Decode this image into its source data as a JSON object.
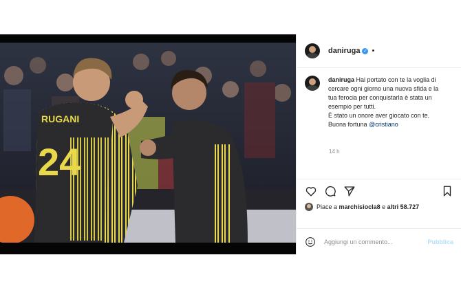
{
  "post": {
    "username": "daniruga",
    "verified_mark": "✓",
    "more_icon": "more-options-icon",
    "caption": {
      "username": "daniruga",
      "text": "Hai portato con te la voglia di cercare ogni giorno una nuova sfida e la tua ferocia per conquistarla è stata un esempio per tutti.",
      "text2": "È stato un onore aver giocato con te.",
      "text3": "Buona fortuna",
      "mention": "@cristiano"
    },
    "time": "14 h",
    "likes": {
      "prefix": "Piace a",
      "user": "marchisiocla8",
      "middle": "e",
      "others": "altri 58.727"
    },
    "comment": {
      "placeholder": "Aggiungi un commento...",
      "publish_label": "Pubblica"
    },
    "photo": {
      "jersey_number": "24",
      "jersey_name": "RUGANI"
    }
  },
  "colors": {
    "verified": "#3897f0",
    "publish": "#b2dffc",
    "mention": "#00376b",
    "jersey": "#2b2b2e",
    "stripe": "#e8d84a"
  },
  "icons": [
    "heart-icon",
    "comment-icon",
    "share-icon",
    "bookmark-icon",
    "emoji-icon"
  ]
}
